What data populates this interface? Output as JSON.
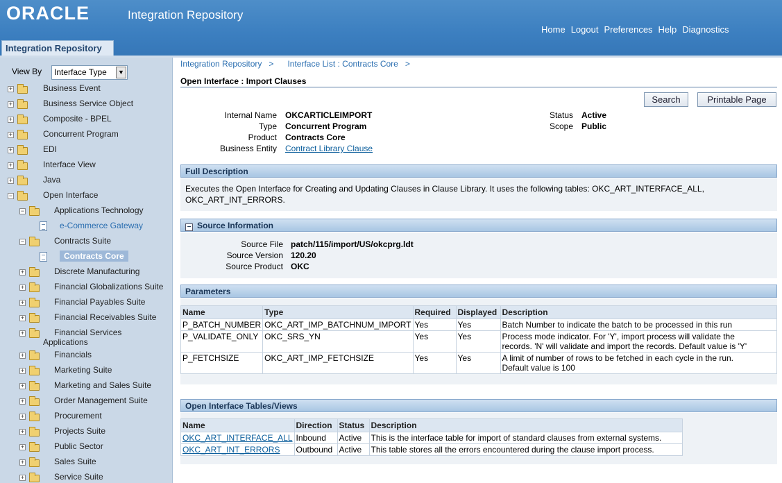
{
  "header": {
    "logo": "ORACLE",
    "title": "Integration Repository",
    "nav": [
      "Home",
      "Logout",
      "Preferences",
      "Help",
      "Diagnostics"
    ],
    "tab": "Integration Repository"
  },
  "sidebar": {
    "viewby_label": "View By",
    "viewby_value": "Interface Type",
    "items": [
      {
        "label": "Business Event"
      },
      {
        "label": "Business Service Object"
      },
      {
        "label": "Composite - BPEL"
      },
      {
        "label": "Concurrent Program"
      },
      {
        "label": "EDI"
      },
      {
        "label": "Interface View"
      },
      {
        "label": "Java"
      },
      {
        "label": "Open Interface"
      },
      {
        "label": "Applications Technology"
      },
      {
        "label": "e-Commerce Gateway"
      },
      {
        "label": "Contracts Suite"
      },
      {
        "label": "Contracts Core"
      },
      {
        "label": "Discrete Manufacturing"
      },
      {
        "label": "Financial Globalizations Suite"
      },
      {
        "label": "Financial Payables Suite"
      },
      {
        "label": "Financial Receivables Suite"
      },
      {
        "label": "Financial Services",
        "label2": "Applications"
      },
      {
        "label": "Financials"
      },
      {
        "label": "Marketing Suite"
      },
      {
        "label": "Marketing and Sales Suite"
      },
      {
        "label": "Order Management Suite"
      },
      {
        "label": "Procurement"
      },
      {
        "label": "Projects Suite"
      },
      {
        "label": "Public Sector"
      },
      {
        "label": "Sales Suite"
      },
      {
        "label": "Service Suite"
      }
    ]
  },
  "breadcrumb": {
    "item1": "Integration Repository",
    "sep": ">",
    "item2": "Interface List : Contracts Core"
  },
  "page": {
    "title": "Open Interface : Import Clauses",
    "search_btn": "Search",
    "print_btn": "Printable Page"
  },
  "info": {
    "internal_name_label": "Internal Name",
    "internal_name": "OKCARTICLEIMPORT",
    "type_label": "Type",
    "type": "Concurrent Program",
    "product_label": "Product",
    "product": "Contracts Core",
    "entity_label": "Business Entity",
    "entity": "Contract Library Clause",
    "status_label": "Status",
    "status": "Active",
    "scope_label": "Scope",
    "scope": "Public"
  },
  "full_description": {
    "header": "Full Description",
    "line1": "Executes the Open Interface for Creating and Updating Clauses in Clause Library. It uses the following tables: OKC_ART_INTERFACE_ALL,",
    "line2": "OKC_ART_INT_ERRORS."
  },
  "source": {
    "header": "Source Information",
    "collapse": "−",
    "file_label": "Source File",
    "file": "patch/115/import/US/okcprg.ldt",
    "version_label": "Source Version",
    "version": "120.20",
    "product_label": "Source Product",
    "product": "OKC"
  },
  "parameters": {
    "header": "Parameters",
    "columns": [
      "Name",
      "Type",
      "Required",
      "Displayed",
      "Description"
    ],
    "rows": [
      {
        "name": "P_BATCH_NUMBER",
        "type": "OKC_ART_IMP_BATCHNUM_IMPORT",
        "required": "Yes",
        "displayed": "Yes",
        "desc1": "Batch Number to indicate the batch to be processed in this run",
        "desc2": ""
      },
      {
        "name": "P_VALIDATE_ONLY",
        "type": "OKC_SRS_YN",
        "required": "Yes",
        "displayed": "Yes",
        "desc1": "Process mode indicator. For 'Y', import process will validate the",
        "desc2": "records. 'N' will validate and import the records. Default value is 'Y'"
      },
      {
        "name": "P_FETCHSIZE",
        "type": "OKC_ART_IMP_FETCHSIZE",
        "required": "Yes",
        "displayed": "Yes",
        "desc1": "A limit of number of rows to be fetched in each cycle in the run.",
        "desc2": "Default value is 100"
      }
    ]
  },
  "tables": {
    "header": "Open Interface Tables/Views",
    "columns": [
      "Name",
      "Direction",
      "Status",
      "Description"
    ],
    "rows": [
      {
        "name": "OKC_ART_INTERFACE_ALL",
        "direction": "Inbound",
        "status": "Active",
        "desc": "This is the interface table for import of standard clauses from external systems."
      },
      {
        "name": "OKC_ART_INT_ERRORS",
        "direction": "Outbound",
        "status": "Active",
        "desc": "This table stores all the errors encountered during the clause import process."
      }
    ]
  }
}
